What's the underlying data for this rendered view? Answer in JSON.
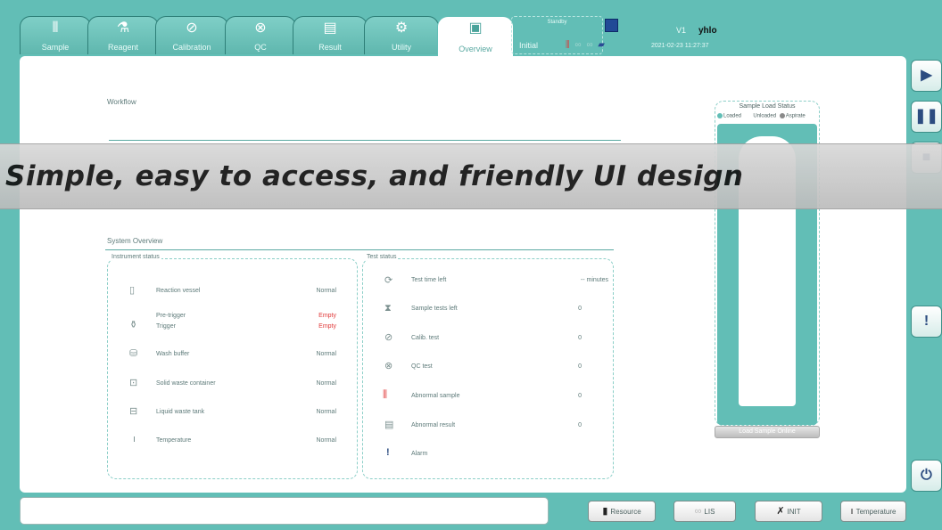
{
  "tabs": [
    {
      "label": "Sample",
      "icon": "test-tubes-icon"
    },
    {
      "label": "Reagent",
      "icon": "reagent-icon"
    },
    {
      "label": "Calibration",
      "icon": "calibration-icon"
    },
    {
      "label": "QC",
      "icon": "qc-icon"
    },
    {
      "label": "Result",
      "icon": "result-document-icon"
    },
    {
      "label": "Utility",
      "icon": "utility-gear-icon"
    },
    {
      "label": "Overview",
      "icon": "overview-monitor-icon",
      "active": true
    }
  ],
  "status": {
    "top": "Standby",
    "bottom": "Initial"
  },
  "header": {
    "version": "V1",
    "user": "yhlo",
    "datetime": "2021-02-23 11:27:37"
  },
  "workflow": {
    "title": "Workflow"
  },
  "banner": {
    "text": "Simple, easy to access, and friendly UI design"
  },
  "system_overview": {
    "title": "System Overview",
    "instrument": {
      "title": "Instrument status",
      "rows": [
        {
          "label": "Reaction vessel",
          "value": "Normal",
          "icon": "reaction-vessel-icon"
        },
        {
          "label": "Pre-trigger",
          "value": "Empty",
          "icon": "trigger-bottles-icon"
        },
        {
          "label": "Trigger",
          "value": "Empty"
        },
        {
          "label": "Wash buffer",
          "value": "Normal",
          "icon": "wash-buffer-icon"
        },
        {
          "label": "Solid waste container",
          "value": "Normal",
          "icon": "solid-waste-icon"
        },
        {
          "label": "Liquid waste tank",
          "value": "Normal",
          "icon": "liquid-waste-icon"
        },
        {
          "label": "Temperature",
          "value": "Normal",
          "icon": "thermometer-icon"
        }
      ]
    },
    "test": {
      "title": "Test status",
      "rows": [
        {
          "label": "Test time left",
          "value": "-- minutes",
          "icon": "timer-icon"
        },
        {
          "label": "Sample tests left",
          "value": "0",
          "icon": "hourglass-icon"
        },
        {
          "label": "Calib. test",
          "value": "0",
          "icon": "calibration-icon"
        },
        {
          "label": "QC test",
          "value": "0",
          "icon": "qc-icon"
        },
        {
          "label": "Abnormal sample",
          "value": "0",
          "icon": "abnormal-sample-icon"
        },
        {
          "label": "Abnormal result",
          "value": "0",
          "icon": "abnormal-result-icon"
        },
        {
          "label": "Alarm",
          "value": "",
          "icon": "alarm-icon"
        }
      ]
    }
  },
  "sample_load": {
    "title": "Sample Load Status",
    "legend": [
      "Loaded",
      "Unloaded",
      "Aspirate"
    ],
    "button": "Load Sample Online"
  },
  "bottom": {
    "resource": "Resource",
    "lis": "LIS",
    "init": "INIT",
    "temperature": "Temperature"
  },
  "colors": {
    "teal": "#62beb6",
    "red": "#e03a3a",
    "navy": "#2c4c80"
  }
}
